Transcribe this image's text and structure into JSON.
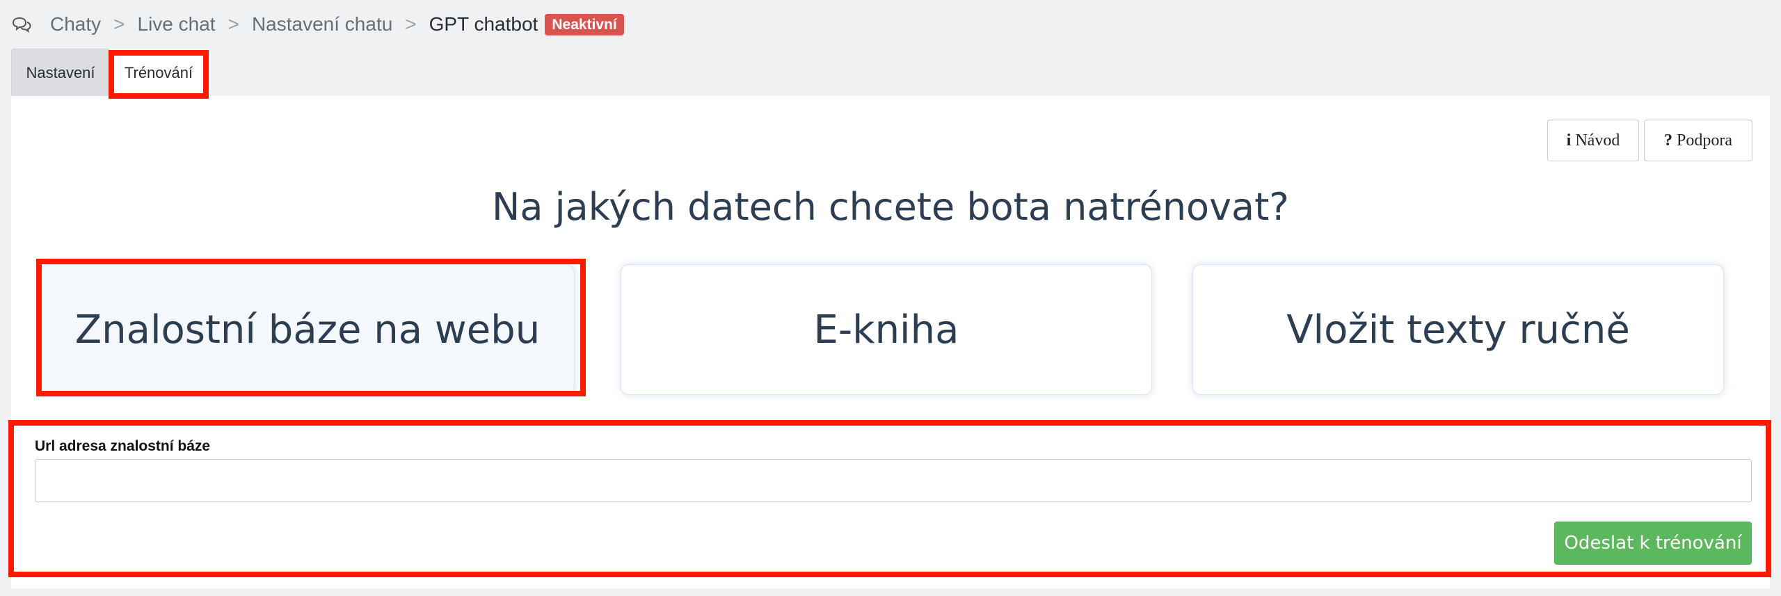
{
  "breadcrumb": {
    "items": [
      "Chaty",
      "Live chat",
      "Nastavení chatu"
    ],
    "separator": ">",
    "current": "GPT chatbot",
    "status_badge": "Neaktivní"
  },
  "tabs": [
    {
      "label": "Nastavení",
      "active": false
    },
    {
      "label": "Trénování",
      "active": true
    }
  ],
  "help_buttons": {
    "guide_icon": "i",
    "guide_label": "Návod",
    "support_icon": "?",
    "support_label": "Podpora"
  },
  "heading": "Na jakých datech chcete bota natrénovat?",
  "options": [
    {
      "label": "Znalostní báze na webu",
      "selected": true
    },
    {
      "label": "E-kniha",
      "selected": false
    },
    {
      "label": "Vložit texty ručně",
      "selected": false
    }
  ],
  "form": {
    "url_label": "Url adresa znalostní báze",
    "url_value": "",
    "submit_label": "Odeslat k trénování"
  },
  "colors": {
    "badge": "#d9534f",
    "submit": "#5cb85c",
    "annotation": "#ff1a00"
  }
}
